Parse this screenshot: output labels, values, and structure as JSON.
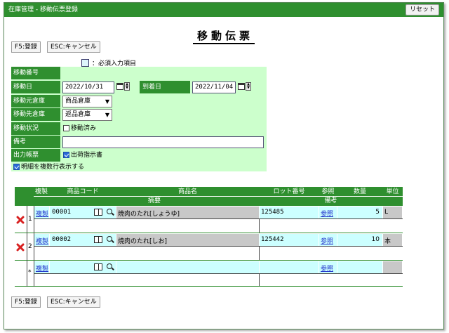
{
  "window": {
    "title": "在庫管理 - 移動伝票登録",
    "reset_label": "リセット"
  },
  "page_title": "移動伝票",
  "toolbar": {
    "register_label": "F5:登録",
    "cancel_label": "ESC:キャンセル"
  },
  "legend": {
    "text": "：必須入力項目"
  },
  "form": {
    "move_no": {
      "label": "移動番号",
      "value": ""
    },
    "move_date": {
      "label": "移動日",
      "value": "2022/10/31"
    },
    "arrive_date": {
      "label": "到着日",
      "value": "2022/11/04"
    },
    "from_warehouse": {
      "label": "移動元倉庫",
      "value": "商品倉庫"
    },
    "to_warehouse": {
      "label": "移動先倉庫",
      "value": "返品倉庫"
    },
    "status": {
      "label": "移動状況",
      "check_label": "移動済み",
      "checked": false
    },
    "note": {
      "label": "備考",
      "value": ""
    },
    "output": {
      "label": "出力帳票",
      "check_label": "出荷指示書",
      "checked": true
    },
    "multiline": {
      "check_label": "明細を複数行表示する",
      "checked": true
    }
  },
  "grid": {
    "headers": {
      "copy": "複製",
      "code": "商品コード",
      "name": "商品名",
      "lot": "ロット番号",
      "ref": "参照",
      "qty": "数量",
      "unit": "単位",
      "summary": "摘要",
      "note": "備考"
    },
    "rows": [
      {
        "no": "1",
        "copy": "複製",
        "code": "00001",
        "name": "焼肉のたれ[しょうゆ]",
        "lot": "125485",
        "ref": "参照",
        "qty": "5",
        "unit": "L"
      },
      {
        "no": "2",
        "copy": "複製",
        "code": "00002",
        "name": "焼肉のたれ[しお]",
        "lot": "125442",
        "ref": "参照",
        "qty": "10",
        "unit": "本"
      },
      {
        "no": "*",
        "copy": "複製",
        "code": "",
        "name": "",
        "lot": "",
        "ref": "参照",
        "qty": "",
        "unit": ""
      }
    ]
  },
  "colors": {
    "header_green": "#2f8f2f",
    "form_bg": "#ccffcc",
    "cyan": "#ccffff",
    "grey": "#c8c8c8"
  },
  "icons": {
    "delete": "red-x-icon",
    "catalog": "book-icon",
    "search": "magnifier-icon",
    "calendar": "calendar-icon"
  }
}
